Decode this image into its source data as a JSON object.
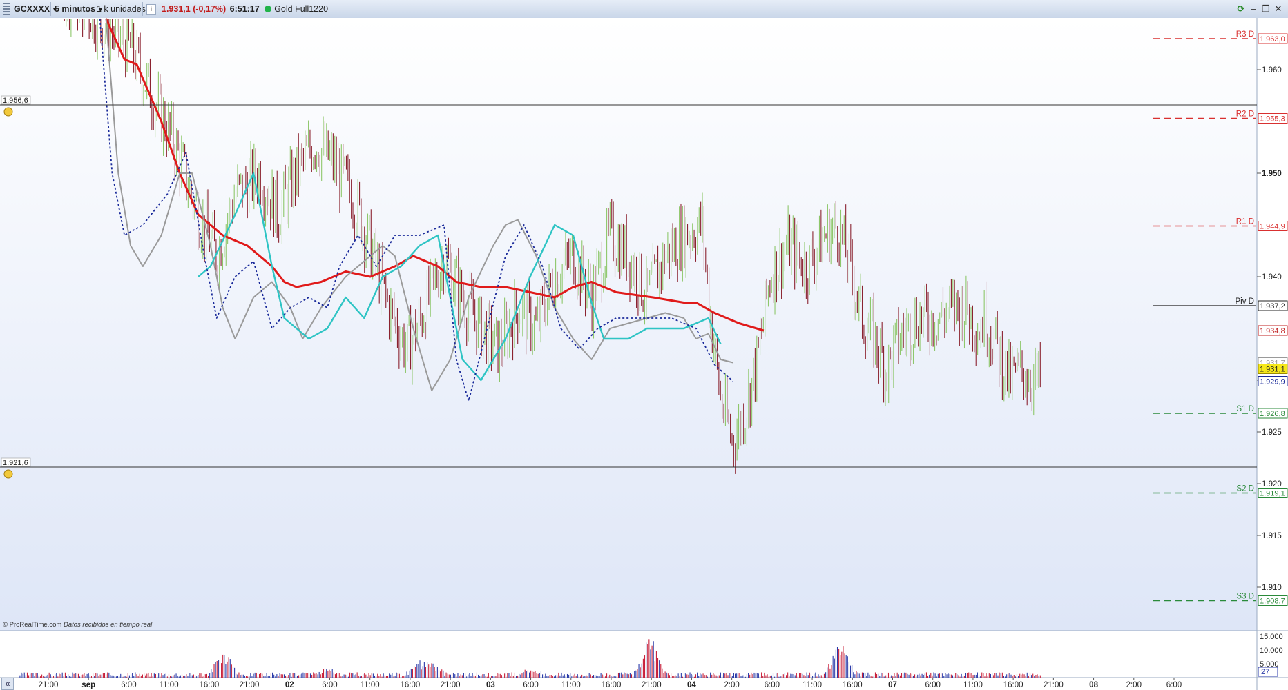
{
  "toolbar": {
    "symbol": "GCXXXX",
    "timeframe": "5 minutos",
    "units": "1 k unidades",
    "price": "1.931,1",
    "change": "(-0,17%)",
    "time": "6:51:17",
    "status_label": "Gold Full1220",
    "icons": [
      "grip-handle",
      "info-icon",
      "live-status-dot",
      "refresh-icon",
      "minimize-icon",
      "restore-icon",
      "close-icon"
    ]
  },
  "colors": {
    "candle_up": "#8ec76b",
    "candle_down": "#8b2330",
    "ma_red": "#e01a1a",
    "ma_grey": "#9a9a9a",
    "ma_cyan": "#2ec4c4",
    "ma_dotted_blue": "#1a2a9a",
    "resistance": "#d93030",
    "support": "#2a8a3a",
    "last_price_bg": "#f5e81a"
  },
  "copyright": {
    "brand": "© ProRealTime.com",
    "note": "Datos recibidos en tiempo real"
  },
  "chart_data": {
    "type": "candlestick",
    "ylim": [
      1905.8,
      1965.0
    ],
    "y_tick_labels": [
      "1.960",
      "1.950",
      "1.940",
      "1.930",
      "1.925",
      "1.920",
      "1.915",
      "1.910"
    ],
    "y_ticks": [
      1960,
      1950,
      1940,
      1930,
      1925,
      1920,
      1915,
      1910
    ],
    "x_tick_labels": [
      {
        "label": "21:00",
        "bold": false
      },
      {
        "label": "sep",
        "bold": true
      },
      {
        "label": "6:00",
        "bold": false
      },
      {
        "label": "11:00",
        "bold": false
      },
      {
        "label": "16:00",
        "bold": false
      },
      {
        "label": "21:00",
        "bold": false
      },
      {
        "label": "02",
        "bold": true
      },
      {
        "label": "6:00",
        "bold": false
      },
      {
        "label": "11:00",
        "bold": false
      },
      {
        "label": "16:00",
        "bold": false
      },
      {
        "label": "21:00",
        "bold": false
      },
      {
        "label": "03",
        "bold": true
      },
      {
        "label": "6:00",
        "bold": false
      },
      {
        "label": "11:00",
        "bold": false
      },
      {
        "label": "16:00",
        "bold": false
      },
      {
        "label": "21:00",
        "bold": false
      },
      {
        "label": "04",
        "bold": true
      },
      {
        "label": "2:00",
        "bold": false
      },
      {
        "label": "6:00",
        "bold": false
      },
      {
        "label": "11:00",
        "bold": false
      },
      {
        "label": "16:00",
        "bold": false
      },
      {
        "label": "07",
        "bold": true
      },
      {
        "label": "6:00",
        "bold": false
      },
      {
        "label": "11:00",
        "bold": false
      },
      {
        "label": "16:00",
        "bold": false
      },
      {
        "label": "21:00",
        "bold": false
      },
      {
        "label": "08",
        "bold": true
      },
      {
        "label": "2:00",
        "bold": false
      },
      {
        "label": "6:00",
        "bold": false
      }
    ],
    "horizontal_lines": [
      {
        "label": "1.956,6",
        "value": 1956.6
      },
      {
        "label": "1.921,6",
        "value": 1921.6
      }
    ],
    "pivot_levels": [
      {
        "name": "R3 D",
        "label": "1.963,0",
        "value": 1963.0,
        "kind": "resistance"
      },
      {
        "name": "R2 D",
        "label": "1.955,3",
        "value": 1955.3,
        "kind": "resistance"
      },
      {
        "name": "R1 D",
        "label": "1.944,9",
        "value": 1944.9,
        "kind": "resistance"
      },
      {
        "name": "Piv D",
        "label": "1.937,2",
        "value": 1937.2,
        "kind": "pivot"
      },
      {
        "name": "S1 D",
        "label": "1.926,8",
        "value": 1926.8,
        "kind": "support"
      },
      {
        "name": "S2 D",
        "label": "1.919,1",
        "value": 1919.1,
        "kind": "support"
      },
      {
        "name": "S3 D",
        "label": "1.908,7",
        "value": 1908.7,
        "kind": "support"
      }
    ],
    "price_tags": [
      {
        "label": "1.934,8",
        "value": 1934.8,
        "kind": "red-ma"
      },
      {
        "label": "1.931,7",
        "value": 1931.7,
        "kind": "grey-ma"
      },
      {
        "label": "1.931,1",
        "value": 1931.1,
        "kind": "last"
      },
      {
        "label": "1.929,9",
        "value": 1929.9,
        "kind": "blue-ma"
      }
    ],
    "close_path": [
      [
        0.0,
        1972
      ],
      [
        0.05,
        1967
      ],
      [
        0.095,
        1962
      ],
      [
        0.13,
        1953
      ],
      [
        0.15,
        1946
      ],
      [
        0.165,
        1942
      ],
      [
        0.18,
        1948
      ],
      [
        0.2,
        1950
      ],
      [
        0.215,
        1946
      ],
      [
        0.23,
        1950
      ],
      [
        0.245,
        1953
      ],
      [
        0.26,
        1951
      ],
      [
        0.275,
        1948
      ],
      [
        0.29,
        1943
      ],
      [
        0.305,
        1937
      ],
      [
        0.32,
        1933
      ],
      [
        0.335,
        1937
      ],
      [
        0.35,
        1942
      ],
      [
        0.365,
        1938
      ],
      [
        0.38,
        1935
      ],
      [
        0.395,
        1933
      ],
      [
        0.41,
        1937
      ],
      [
        0.425,
        1935
      ],
      [
        0.44,
        1940
      ],
      [
        0.455,
        1942
      ],
      [
        0.47,
        1938
      ],
      [
        0.485,
        1944
      ],
      [
        0.5,
        1942
      ],
      [
        0.515,
        1938
      ],
      [
        0.53,
        1942
      ],
      [
        0.545,
        1944
      ],
      [
        0.56,
        1945
      ],
      [
        0.565,
        1938
      ],
      [
        0.575,
        1928
      ],
      [
        0.585,
        1924
      ],
      [
        0.595,
        1927
      ],
      [
        0.605,
        1932
      ],
      [
        0.615,
        1940
      ],
      [
        0.63,
        1943
      ],
      [
        0.645,
        1941
      ],
      [
        0.66,
        1944
      ],
      [
        0.67,
        1945
      ],
      [
        0.68,
        1941
      ],
      [
        0.69,
        1936
      ],
      [
        0.7,
        1934
      ],
      [
        0.71,
        1931
      ],
      [
        0.72,
        1934
      ],
      [
        0.735,
        1936
      ],
      [
        0.75,
        1936
      ],
      [
        0.765,
        1937
      ],
      [
        0.775,
        1937
      ],
      [
        0.785,
        1935
      ],
      [
        0.79,
        1936
      ],
      [
        0.8,
        1933
      ],
      [
        0.81,
        1930
      ],
      [
        0.82,
        1931
      ],
      [
        0.83,
        1930
      ],
      [
        0.835,
        1930
      ]
    ],
    "series": [
      {
        "id": "ma-red",
        "points": [
          [
            0.075,
            1975
          ],
          [
            0.09,
            1961
          ],
          [
            0.1,
            1960.5
          ],
          [
            0.12,
            1955
          ],
          [
            0.135,
            1950
          ],
          [
            0.15,
            1946
          ],
          [
            0.17,
            1944
          ],
          [
            0.19,
            1943
          ],
          [
            0.21,
            1941
          ],
          [
            0.22,
            1939.5
          ],
          [
            0.23,
            1939
          ],
          [
            0.25,
            1939.5
          ],
          [
            0.27,
            1940.5
          ],
          [
            0.29,
            1940
          ],
          [
            0.31,
            1941
          ],
          [
            0.325,
            1942
          ],
          [
            0.345,
            1941
          ],
          [
            0.36,
            1939.5
          ],
          [
            0.38,
            1939
          ],
          [
            0.4,
            1939
          ],
          [
            0.42,
            1938.5
          ],
          [
            0.44,
            1938
          ],
          [
            0.455,
            1939
          ],
          [
            0.47,
            1939.5
          ],
          [
            0.49,
            1938.5
          ],
          [
            0.52,
            1938
          ],
          [
            0.545,
            1937.5
          ],
          [
            0.555,
            1937.5
          ],
          [
            0.57,
            1936.5
          ],
          [
            0.59,
            1935.5
          ],
          [
            0.61,
            1934.8
          ]
        ]
      },
      {
        "id": "ma-grey",
        "points": [
          [
            0.075,
            1970
          ],
          [
            0.085,
            1950
          ],
          [
            0.095,
            1943
          ],
          [
            0.105,
            1941
          ],
          [
            0.12,
            1944
          ],
          [
            0.135,
            1950
          ],
          [
            0.145,
            1950
          ],
          [
            0.16,
            1943
          ],
          [
            0.17,
            1937
          ],
          [
            0.18,
            1934
          ],
          [
            0.195,
            1938
          ],
          [
            0.21,
            1939.5
          ],
          [
            0.225,
            1937
          ],
          [
            0.235,
            1934
          ],
          [
            0.25,
            1937
          ],
          [
            0.27,
            1940
          ],
          [
            0.29,
            1942
          ],
          [
            0.3,
            1943
          ],
          [
            0.31,
            1942
          ],
          [
            0.325,
            1935
          ],
          [
            0.34,
            1929
          ],
          [
            0.355,
            1932
          ],
          [
            0.37,
            1938
          ],
          [
            0.39,
            1943
          ],
          [
            0.4,
            1945
          ],
          [
            0.41,
            1945.5
          ],
          [
            0.425,
            1942
          ],
          [
            0.44,
            1937
          ],
          [
            0.455,
            1934
          ],
          [
            0.47,
            1932
          ],
          [
            0.485,
            1935
          ],
          [
            0.5,
            1935.5
          ],
          [
            0.53,
            1936.5
          ],
          [
            0.545,
            1936
          ],
          [
            0.555,
            1934
          ],
          [
            0.565,
            1934.5
          ],
          [
            0.575,
            1932
          ],
          [
            0.585,
            1931.7
          ]
        ]
      },
      {
        "id": "ma-cyan",
        "points": [
          [
            0.15,
            1940
          ],
          [
            0.16,
            1941
          ],
          [
            0.18,
            1946
          ],
          [
            0.195,
            1950
          ],
          [
            0.21,
            1941
          ],
          [
            0.22,
            1936
          ],
          [
            0.24,
            1934
          ],
          [
            0.255,
            1935
          ],
          [
            0.27,
            1938
          ],
          [
            0.285,
            1936
          ],
          [
            0.3,
            1940
          ],
          [
            0.315,
            1941
          ],
          [
            0.33,
            1943
          ],
          [
            0.345,
            1944
          ],
          [
            0.355,
            1938
          ],
          [
            0.365,
            1932
          ],
          [
            0.38,
            1930
          ],
          [
            0.4,
            1934
          ],
          [
            0.42,
            1940
          ],
          [
            0.44,
            1945
          ],
          [
            0.455,
            1944
          ],
          [
            0.47,
            1937.5
          ],
          [
            0.48,
            1934
          ],
          [
            0.5,
            1934
          ],
          [
            0.515,
            1935
          ],
          [
            0.545,
            1935
          ],
          [
            0.565,
            1936
          ],
          [
            0.575,
            1933.5
          ]
        ]
      },
      {
        "id": "ma-blue-dotted",
        "points": [
          [
            0.07,
            1968
          ],
          [
            0.08,
            1950
          ],
          [
            0.09,
            1944
          ],
          [
            0.105,
            1945
          ],
          [
            0.125,
            1948
          ],
          [
            0.14,
            1952
          ],
          [
            0.155,
            1942
          ],
          [
            0.165,
            1936
          ],
          [
            0.18,
            1940
          ],
          [
            0.195,
            1941.5
          ],
          [
            0.21,
            1935
          ],
          [
            0.225,
            1937
          ],
          [
            0.24,
            1938
          ],
          [
            0.255,
            1937
          ],
          [
            0.265,
            1941
          ],
          [
            0.28,
            1944
          ],
          [
            0.295,
            1941
          ],
          [
            0.31,
            1944
          ],
          [
            0.33,
            1944
          ],
          [
            0.35,
            1945
          ],
          [
            0.36,
            1932
          ],
          [
            0.37,
            1928
          ],
          [
            0.385,
            1935
          ],
          [
            0.4,
            1942
          ],
          [
            0.415,
            1945
          ],
          [
            0.43,
            1941
          ],
          [
            0.445,
            1935
          ],
          [
            0.46,
            1933
          ],
          [
            0.475,
            1935
          ],
          [
            0.49,
            1936
          ],
          [
            0.52,
            1936
          ],
          [
            0.535,
            1936
          ],
          [
            0.555,
            1935
          ],
          [
            0.57,
            1931.5
          ],
          [
            0.585,
            1929.9
          ]
        ]
      }
    ],
    "volume_ticks": [
      "15.000",
      "10.000",
      "5.000"
    ],
    "volume_tick_values": [
      15000,
      10000,
      5000
    ],
    "volume_current": "27",
    "volume_peaks": [
      {
        "x": 0.17,
        "value": 11000
      },
      {
        "x": 0.33,
        "value": 5500
      },
      {
        "x": 0.34,
        "value": 4200
      },
      {
        "x": 0.515,
        "value": 7000
      },
      {
        "x": 0.52,
        "value": 10000
      },
      {
        "x": 0.67,
        "value": 9000
      },
      {
        "x": 0.675,
        "value": 6500
      },
      {
        "x": 0.255,
        "value": 2000
      },
      {
        "x": 0.42,
        "value": 1800
      }
    ]
  }
}
